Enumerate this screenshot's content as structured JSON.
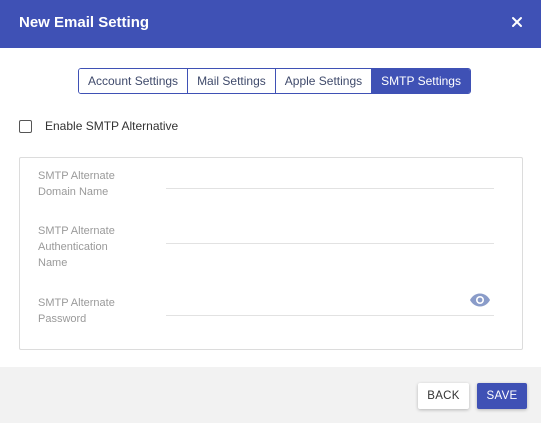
{
  "dialog": {
    "title": "New Email Setting",
    "close_icon": "close-icon"
  },
  "tabs": [
    {
      "label": "Account Settings",
      "active": false
    },
    {
      "label": "Mail Settings",
      "active": false
    },
    {
      "label": "Apple Settings",
      "active": false
    },
    {
      "label": "SMTP Settings",
      "active": true
    }
  ],
  "smtp": {
    "enable_alternative_label": "Enable SMTP Alternative",
    "enable_alternative_checked": false,
    "fields": [
      {
        "label_line1": "SMTP Alternate",
        "label_line2": "Domain Name",
        "label_line3": "",
        "value": ""
      },
      {
        "label_line1": "SMTP Alternate",
        "label_line2": "Authentication",
        "label_line3": "Name",
        "value": ""
      },
      {
        "label_line1": "SMTP Alternate",
        "label_line2": "Password",
        "label_line3": "",
        "value": ""
      }
    ],
    "password_toggle_icon": "eye-icon"
  },
  "footer": {
    "back_label": "BACK",
    "save_label": "SAVE"
  },
  "colors": {
    "primary": "#3f51b5",
    "footer_bg": "#f2f2f2",
    "label_gray": "#9a9a9a"
  }
}
